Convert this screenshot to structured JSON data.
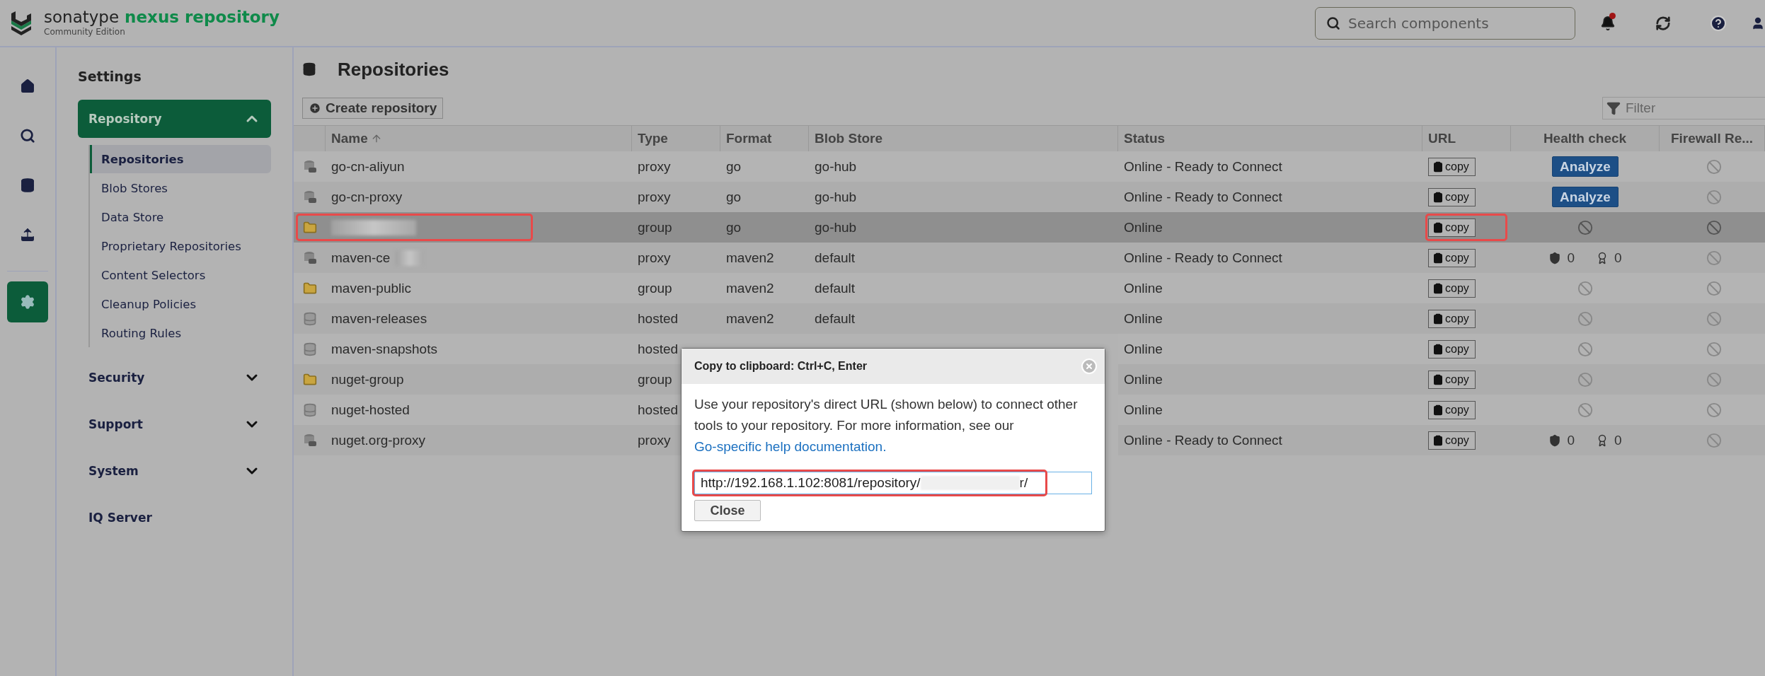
{
  "header": {
    "brand": "sonatype",
    "product": "nexus repository",
    "edition": "Community Edition",
    "search": {
      "placeholder": "Search components"
    },
    "notification_dot": true
  },
  "rail": [
    {
      "kind": "home",
      "selected": false
    },
    {
      "kind": "search",
      "selected": false
    },
    {
      "kind": "database",
      "selected": false
    },
    {
      "kind": "upload",
      "selected": false
    },
    {
      "kind": "settings",
      "selected": true
    }
  ],
  "sidebar": {
    "title": "Settings",
    "sections": [
      {
        "label": "Repository",
        "expanded": true,
        "children": [
          {
            "label": "Repositories",
            "selected": true
          },
          {
            "label": "Blob Stores",
            "selected": false
          },
          {
            "label": "Data Store",
            "selected": false
          },
          {
            "label": "Proprietary Repositories",
            "selected": false
          },
          {
            "label": "Content Selectors",
            "selected": false
          },
          {
            "label": "Cleanup Policies",
            "selected": false
          },
          {
            "label": "Routing Rules",
            "selected": false
          }
        ]
      },
      {
        "label": "Security",
        "expanded": false
      },
      {
        "label": "Support",
        "expanded": false
      },
      {
        "label": "System",
        "expanded": false
      },
      {
        "label": "IQ Server"
      }
    ]
  },
  "page": {
    "title": "Repositories",
    "create_button": "Create repository",
    "filter": {
      "placeholder": "Filter"
    }
  },
  "table": {
    "columns": [
      {
        "label": "Name",
        "sorted": true
      },
      {
        "label": "Type"
      },
      {
        "label": "Format"
      },
      {
        "label": "Blob Store"
      },
      {
        "label": "Status"
      },
      {
        "label": "URL"
      },
      {
        "label": "Health check"
      },
      {
        "label": "Firewall Re..."
      }
    ],
    "rows": [
      {
        "kind": "proxy",
        "name": "go-cn-aliyun",
        "type": "proxy",
        "format": "go",
        "blob_store": "go-hub",
        "status": "Online - Ready to Connect",
        "copy": "copy",
        "health": {
          "kind": "analyze",
          "label": "Analyze"
        },
        "selected": false
      },
      {
        "kind": "proxy",
        "name": "go-cn-proxy",
        "type": "proxy",
        "format": "go",
        "blob_store": "go-hub",
        "status": "Online - Ready to Connect",
        "copy": "copy",
        "health": {
          "kind": "analyze",
          "label": "Analyze"
        },
        "selected": false
      },
      {
        "kind": "group",
        "redacted": true,
        "name_highlighted": true,
        "type": "group",
        "format": "go",
        "blob_store": "go-hub",
        "status": "Online",
        "copy": "copy",
        "copy_highlighted": true,
        "health": {
          "kind": "none"
        },
        "selected": true
      },
      {
        "kind": "proxy",
        "name": "maven-ce",
        "redacted": true,
        "type": "proxy",
        "format": "maven2",
        "blob_store": "default",
        "status": "Online - Ready to Connect",
        "copy": "copy",
        "health": {
          "kind": "counts",
          "security": "0",
          "license": "0"
        },
        "selected": false
      },
      {
        "kind": "group",
        "name": "maven-public",
        "type": "group",
        "format": "maven2",
        "blob_store": "default",
        "status": "Online",
        "copy": "copy",
        "health": {
          "kind": "none"
        },
        "selected": false
      },
      {
        "kind": "hosted",
        "name": "maven-releases",
        "type": "hosted",
        "format": "maven2",
        "blob_store": "default",
        "status": "Online",
        "copy": "copy",
        "health": {
          "kind": "none"
        },
        "selected": false
      },
      {
        "kind": "hosted",
        "name": "maven-snapshots",
        "type": "hosted",
        "status": "Online",
        "copy": "copy",
        "health": {
          "kind": "none"
        },
        "selected": false
      },
      {
        "kind": "group",
        "name": "nuget-group",
        "type": "group",
        "status": "Online",
        "copy": "copy",
        "health": {
          "kind": "none"
        },
        "selected": false
      },
      {
        "kind": "hosted",
        "name": "nuget-hosted",
        "type": "hosted",
        "status": "Online",
        "copy": "copy",
        "health": {
          "kind": "none"
        },
        "selected": false
      },
      {
        "kind": "proxy",
        "name": "nuget.org-proxy",
        "type": "proxy",
        "status": "Online - Ready to Connect",
        "copy": "copy",
        "health": {
          "kind": "counts",
          "security": "0",
          "license": "0"
        },
        "selected": false
      }
    ]
  },
  "dialog": {
    "title": "Copy to clipboard: Ctrl+C, Enter",
    "text": "Use your repository's direct URL (shown below) to connect other tools to your repository. For more information, see our ",
    "link": "Go-specific help documentation.",
    "url_prefix": "http://192.168.1.102:8081/repository/",
    "url_suffix": "r/",
    "url_highlighted": true,
    "close_button": "Close"
  }
}
